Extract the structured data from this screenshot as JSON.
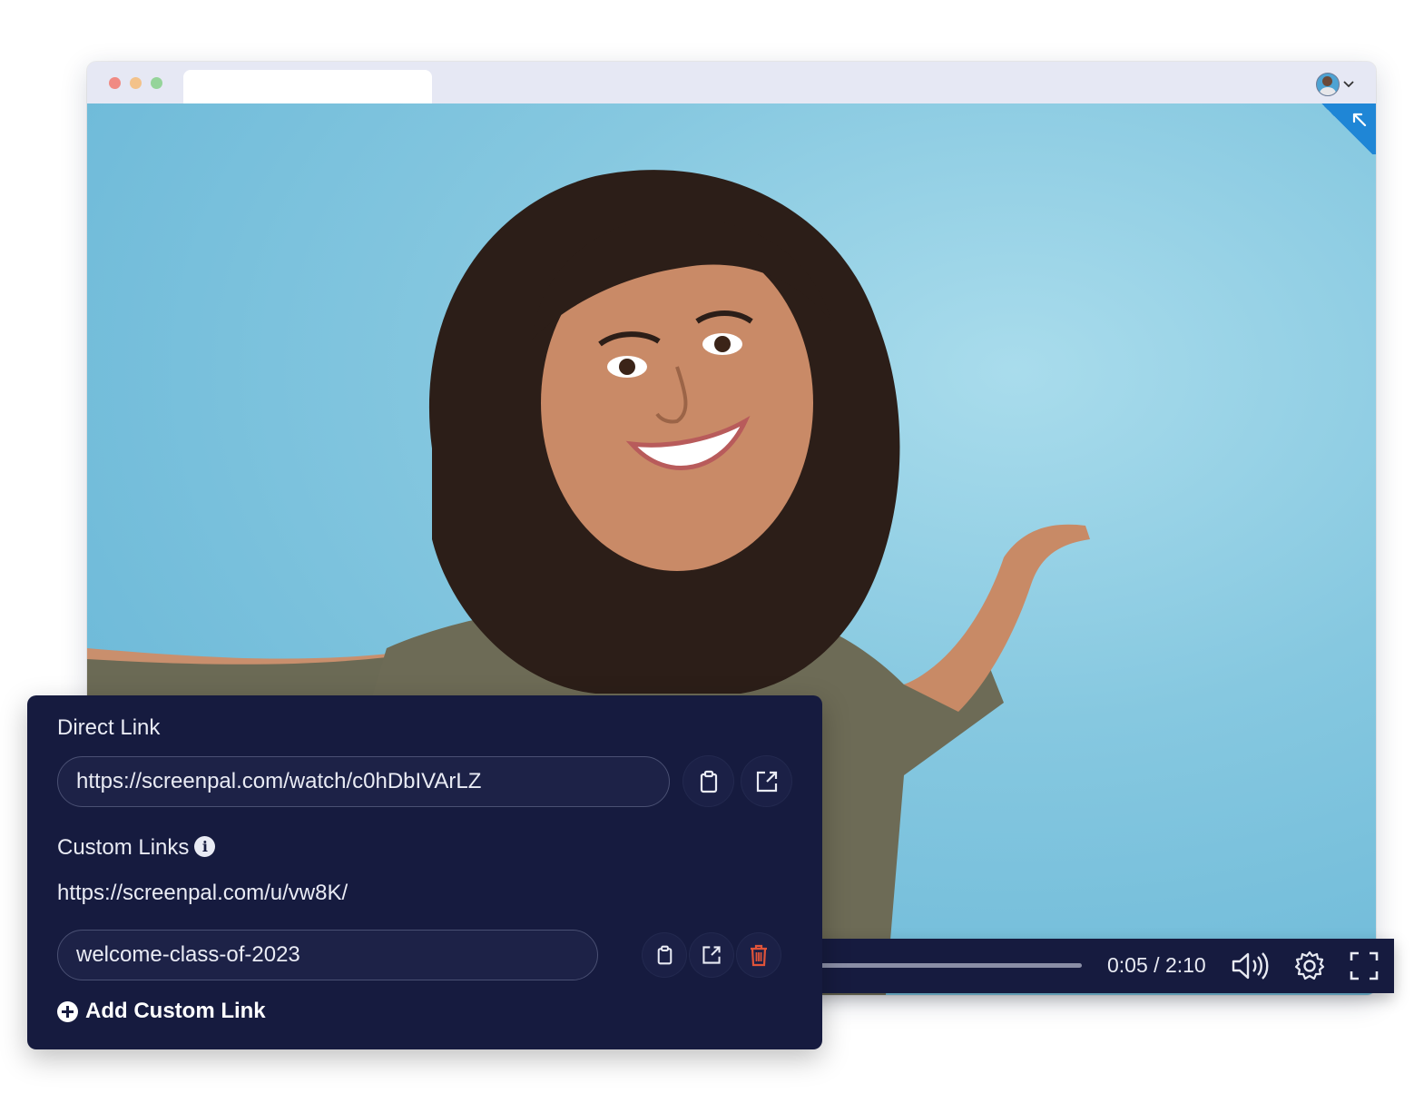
{
  "browser": {
    "tab_title": "",
    "profile_chevron": "⌄"
  },
  "player": {
    "current_time": "0:05",
    "duration": "2:10",
    "time_display": "0:05 / 2:10",
    "progress_fraction": 0.038
  },
  "share_panel": {
    "direct_link_label": "Direct Link",
    "direct_link_url": "https://screenpal.com/watch/c0hDbIVArLZ",
    "custom_links_label": "Custom Links",
    "custom_base_url": "https://screenpal.com/u/vw8K/",
    "custom_link_slug": "welcome-class-of-2023",
    "add_custom_link_label": "Add Custom Link"
  },
  "colors": {
    "panel_bg": "#161b3f",
    "accent_blue": "#1f86d6",
    "delete_red": "#e0543a",
    "video_bg": "#86c8e0"
  },
  "icons": [
    "clipboard-icon",
    "external-link-icon",
    "trash-icon",
    "info-icon",
    "plus-circle-icon",
    "volume-icon",
    "gear-icon",
    "fullscreen-icon",
    "collapse-arrow-icon",
    "chevron-down-icon"
  ]
}
